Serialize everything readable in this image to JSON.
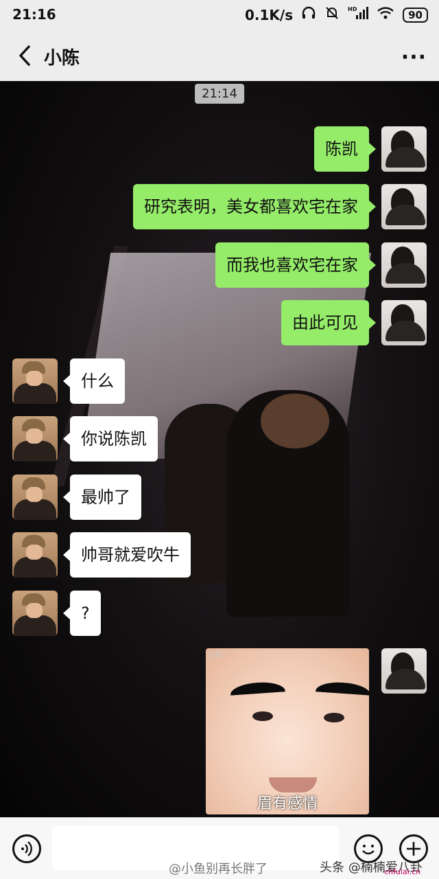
{
  "status_bar": {
    "time": "21:16",
    "network_speed": "0.1K/s",
    "network_label": "HD",
    "battery": "90"
  },
  "header": {
    "back_icon": "chevron-left-icon",
    "title": "小陈",
    "more_label": "···"
  },
  "chat": {
    "timestamp": "21:14",
    "messages": [
      {
        "side": "right",
        "text": "陈凯"
      },
      {
        "side": "right",
        "text": "研究表明，美女都喜欢宅在家"
      },
      {
        "side": "right",
        "text": "而我也喜欢宅在家"
      },
      {
        "side": "right",
        "text": "由此可见"
      },
      {
        "side": "left",
        "text": "什么"
      },
      {
        "side": "left",
        "text": "你说陈凯"
      },
      {
        "side": "left",
        "text": "最帅了"
      },
      {
        "side": "left",
        "text": "帅哥就爱吹牛"
      },
      {
        "side": "left",
        "text": "?"
      },
      {
        "side": "right",
        "type": "sticker",
        "caption": "眉有感情",
        "watermark": "@昵"
      }
    ]
  },
  "input_bar": {
    "voice_icon": "voice-icon",
    "emoji_icon": "emoji-icon",
    "plus_icon": "plus-icon"
  },
  "watermarks": {
    "weibo": "@小鱼别再长胖了",
    "toutiao": "头条 @楠楠爱八卦",
    "site": "cnfulai.cn"
  },
  "colors": {
    "outgoing_bubble": "#95ec69",
    "incoming_bubble": "#ffffff",
    "header_bg": "#ededed"
  }
}
